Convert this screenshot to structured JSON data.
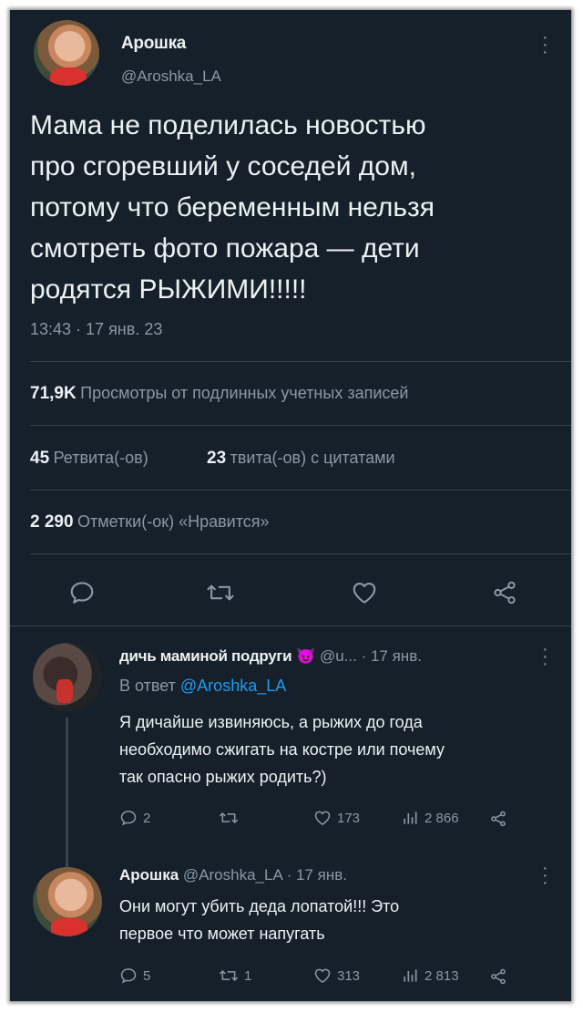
{
  "tweet": {
    "author_name": "Арошка",
    "author_handle": "@Aroshka_LA",
    "text_lines": [
      "Мама не поделилась новостью",
      "про сгоревший у соседей дом,",
      "потому что беременным нельзя",
      "смотреть фото пожара — дети",
      "родятся РЫЖИМИ!!!!!"
    ],
    "timestamp": "13:43 · 17 янв. 23",
    "views_count": "71,9K",
    "views_label": "Просмотры от подлинных учетных записей",
    "retweets_count": "45",
    "retweets_label": "Ретвита(-ов)",
    "quotes_count": "23",
    "quotes_label": "твита(-ов) с цитатами",
    "likes_count": "2 290",
    "likes_label": "Отметки(-ок) «Нравится»",
    "actions": [
      "reply-icon",
      "retweet-icon",
      "like-icon",
      "share-icon"
    ]
  },
  "replies": [
    {
      "author_name": "дичь маминой подруги",
      "author_emoji": "😈",
      "author_handle": "@u...",
      "time": "· 17 янв.",
      "reply_to_prefix": "В ответ",
      "reply_to_handle": "@Aroshka_LA",
      "text_lines": [
        "Я дичайше извиняюсь, а рыжих до года",
        "необходимо сжигать на костре или почему",
        "так опасно рыжих родить?)"
      ],
      "reply_count": "2",
      "retweet_count": "",
      "like_count": "173",
      "views_count": "2 866"
    },
    {
      "author_name": "Арошка",
      "author_handle": "@Aroshka_LA",
      "time": "· 17 янв.",
      "text_lines": [
        "Они могут убить деда лопатой!!! Это",
        "первое что может напугать"
      ],
      "reply_count": "5",
      "retweet_count": "1",
      "like_count": "313",
      "views_count": "2 813"
    }
  ],
  "colors": {
    "background": "#15202b",
    "text": "#eef1f3",
    "muted": "#8b98a5",
    "link": "#1d9bf0",
    "divider": "#38444d"
  }
}
